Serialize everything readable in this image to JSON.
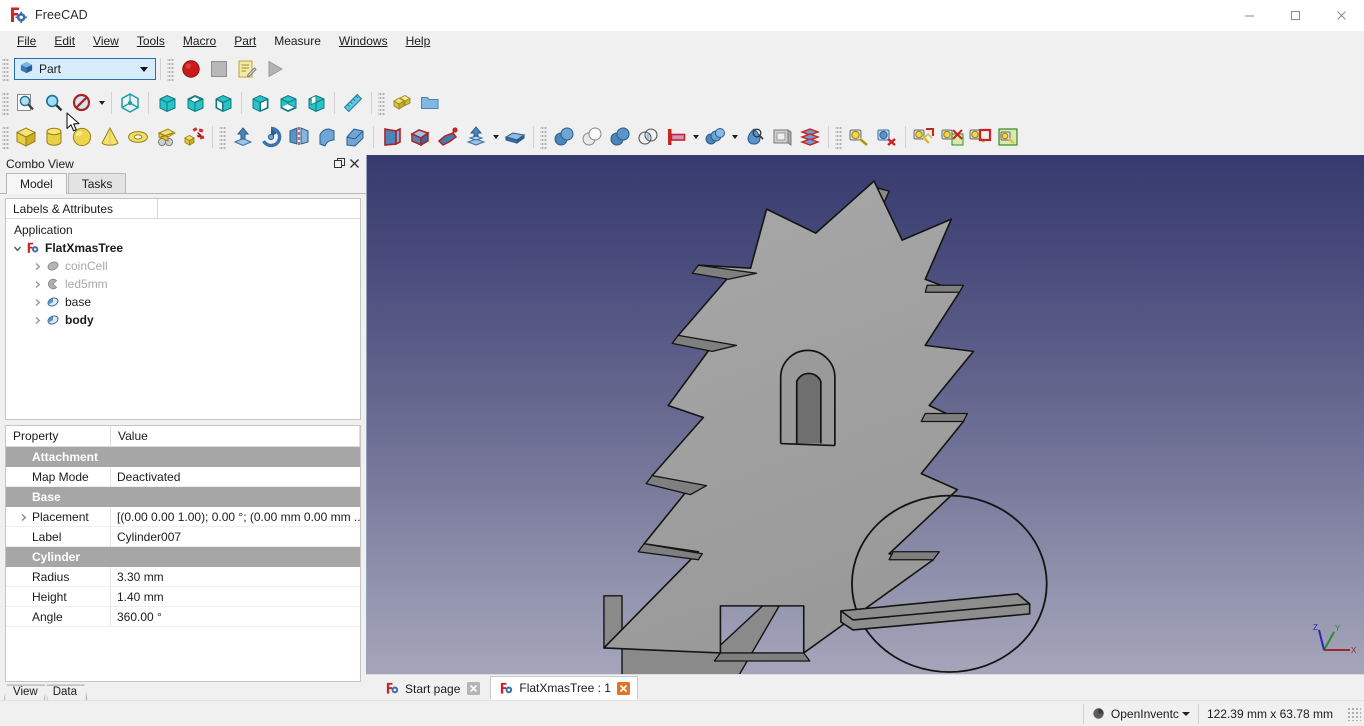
{
  "window": {
    "title": "FreeCAD",
    "app_icon": "freecad-logo-icon",
    "minimize_label": "Minimize",
    "maximize_label": "Maximize",
    "close_label": "Close"
  },
  "menubar": {
    "items": [
      {
        "label": "File",
        "mnemonic": "F"
      },
      {
        "label": "Edit",
        "mnemonic": "E"
      },
      {
        "label": "View",
        "mnemonic": "V"
      },
      {
        "label": "Tools",
        "mnemonic": "T"
      },
      {
        "label": "Macro",
        "mnemonic": "M"
      },
      {
        "label": "Part",
        "mnemonic": "P"
      },
      {
        "label": "Measure",
        "mnemonic": ""
      },
      {
        "label": "Windows",
        "mnemonic": "W"
      },
      {
        "label": "Help",
        "mnemonic": "H"
      }
    ]
  },
  "workbench": {
    "selected": "Part",
    "icon": "part-workbench-icon"
  },
  "macro_toolbar": {
    "buttons": [
      {
        "name": "macro-record-icon",
        "tip": "Macro recording"
      },
      {
        "name": "macro-stop-icon",
        "tip": "Stop macro recording"
      },
      {
        "name": "macro-edit-icon",
        "tip": "Macros"
      },
      {
        "name": "macro-execute-icon",
        "tip": "Execute macro"
      }
    ]
  },
  "view_toolbar": {
    "buttons": [
      {
        "name": "fit-all-icon",
        "tip": "Fit all"
      },
      {
        "name": "fit-selection-icon",
        "tip": "Fit selection"
      },
      {
        "name": "draw-style-icon",
        "tip": "Draw style"
      },
      {
        "name": "isometric-view-icon",
        "tip": "Axonometric"
      },
      {
        "name": "front-view-icon",
        "tip": "Front"
      },
      {
        "name": "top-view-icon",
        "tip": "Top"
      },
      {
        "name": "right-view-icon",
        "tip": "Right"
      },
      {
        "name": "rear-view-icon",
        "tip": "Rear"
      },
      {
        "name": "bottom-view-icon",
        "tip": "Bottom"
      },
      {
        "name": "left-view-icon",
        "tip": "Left"
      },
      {
        "name": "measure-icon",
        "tip": "Measure"
      }
    ]
  },
  "structure_toolbar": {
    "buttons": [
      {
        "name": "create-part-icon",
        "tip": "Create part"
      },
      {
        "name": "create-group-icon",
        "tip": "Create group"
      }
    ]
  },
  "primitives_toolbar": {
    "buttons": [
      {
        "name": "box-primitive-icon",
        "tip": "Cube"
      },
      {
        "name": "cylinder-primitive-icon",
        "tip": "Cylinder"
      },
      {
        "name": "sphere-primitive-icon",
        "tip": "Sphere"
      },
      {
        "name": "cone-primitive-icon",
        "tip": "Cone"
      },
      {
        "name": "torus-primitive-icon",
        "tip": "Torus"
      },
      {
        "name": "create-primitives-icon",
        "tip": "Create primitives"
      },
      {
        "name": "shape-builder-icon",
        "tip": "Shape builder"
      }
    ]
  },
  "part_toolbar": {
    "buttons": [
      {
        "name": "extrude-icon",
        "tip": "Extrude"
      },
      {
        "name": "revolve-icon",
        "tip": "Revolve"
      },
      {
        "name": "mirror-icon",
        "tip": "Mirroring"
      },
      {
        "name": "fillet-icon",
        "tip": "Fillet"
      },
      {
        "name": "chamfer-icon",
        "tip": "Chamfer"
      },
      {
        "name": "ruled-surface-icon",
        "tip": "Ruled surface"
      },
      {
        "name": "loft-icon",
        "tip": "Loft"
      },
      {
        "name": "sweep-icon",
        "tip": "Sweep"
      },
      {
        "name": "offset-icon",
        "tip": "3D Offset"
      },
      {
        "name": "thickness-icon",
        "tip": "Thickness"
      }
    ]
  },
  "boolean_toolbar": {
    "buttons": [
      {
        "name": "boolean-icon",
        "tip": "Boolean"
      },
      {
        "name": "cut-icon",
        "tip": "Cut"
      },
      {
        "name": "union-icon",
        "tip": "Union"
      },
      {
        "name": "intersection-icon",
        "tip": "Intersection"
      },
      {
        "name": "join-connect-icon",
        "tip": "Join objects"
      },
      {
        "name": "split-icon",
        "tip": "Split"
      },
      {
        "name": "compound-filter-icon",
        "tip": "Compound filter"
      },
      {
        "name": "cross-sections-icon",
        "tip": "Cross sections"
      },
      {
        "name": "slice-apart-icon",
        "tip": "Slice apart"
      }
    ]
  },
  "measure_toolbar": {
    "buttons": [
      {
        "name": "measure-linear-icon",
        "tip": "Measure linear"
      },
      {
        "name": "measure-angular-icon",
        "tip": "Measure angular"
      },
      {
        "name": "measure-refresh-icon",
        "tip": "Refresh"
      },
      {
        "name": "measure-toggle-all-icon",
        "tip": "Toggle all"
      },
      {
        "name": "measure-clear-all-icon",
        "tip": "Clear all"
      },
      {
        "name": "measure-toggle-delta-icon",
        "tip": "Toggle delta"
      }
    ]
  },
  "combo_view": {
    "title": "Combo View",
    "float_label": "Float",
    "close_label": "Close",
    "tabs": [
      {
        "label": "Model",
        "active": true
      },
      {
        "label": "Tasks",
        "active": false
      }
    ],
    "tree": {
      "column_header": "Labels & Attributes",
      "root": "Application",
      "nodes": [
        {
          "label": "FlatXmasTree",
          "level": 0,
          "bold": true,
          "dim": false,
          "expanded": true,
          "icon": "freecad-document-icon"
        },
        {
          "label": "coinCell",
          "level": 1,
          "bold": false,
          "dim": true,
          "expanded": false,
          "icon": "part-feature-grey-icon"
        },
        {
          "label": "led5mm",
          "level": 1,
          "bold": false,
          "dim": true,
          "expanded": false,
          "icon": "part-feature-grey-icon"
        },
        {
          "label": "base",
          "level": 1,
          "bold": false,
          "dim": false,
          "expanded": false,
          "icon": "part-feature-blue-icon"
        },
        {
          "label": "body",
          "level": 1,
          "bold": true,
          "dim": false,
          "expanded": false,
          "icon": "part-feature-blue-icon"
        }
      ]
    },
    "properties": {
      "columns": [
        "Property",
        "Value"
      ],
      "rows": [
        {
          "type": "group",
          "name": "Attachment"
        },
        {
          "type": "prop",
          "name": "Map Mode",
          "value": "Deactivated",
          "expandable": false
        },
        {
          "type": "group",
          "name": "Base"
        },
        {
          "type": "prop",
          "name": "Placement",
          "value": "[(0.00 0.00 1.00); 0.00 °; (0.00 mm  0.00 mm  ...",
          "expandable": true
        },
        {
          "type": "prop",
          "name": "Label",
          "value": "Cylinder007",
          "expandable": false
        },
        {
          "type": "group",
          "name": "Cylinder"
        },
        {
          "type": "prop",
          "name": "Radius",
          "value": "3.30 mm",
          "expandable": false
        },
        {
          "type": "prop",
          "name": "Height",
          "value": "1.40 mm",
          "expandable": false
        },
        {
          "type": "prop",
          "name": "Angle",
          "value": "360.00 °",
          "expandable": false
        }
      ]
    },
    "bottom_tabs": [
      {
        "label": "View",
        "active": false
      },
      {
        "label": "Data",
        "active": true
      }
    ]
  },
  "viewport": {
    "background_top": "#363a6e",
    "background_bottom": "#a5a5ba",
    "model_face_color": "#a0a0a0",
    "model_edge_color": "#1a1a1a",
    "axis": {
      "x_label": "X",
      "y_label": "Y",
      "z_label": "Z",
      "x_color": "#a02828",
      "y_color": "#2a8c2a",
      "z_color": "#2a2ab0"
    }
  },
  "mdi_tabs": [
    {
      "label": "Start page",
      "active": false,
      "icon": "freecad-logo-icon",
      "close_label": "×"
    },
    {
      "label": "FlatXmasTree : 1",
      "active": true,
      "icon": "freecad-logo-icon",
      "close_label": "×"
    }
  ],
  "statusbar": {
    "renderer": "OpenInventc",
    "renderer_icon": "render-sphere-icon",
    "dimensions": "122.39 mm x 63.78 mm"
  }
}
